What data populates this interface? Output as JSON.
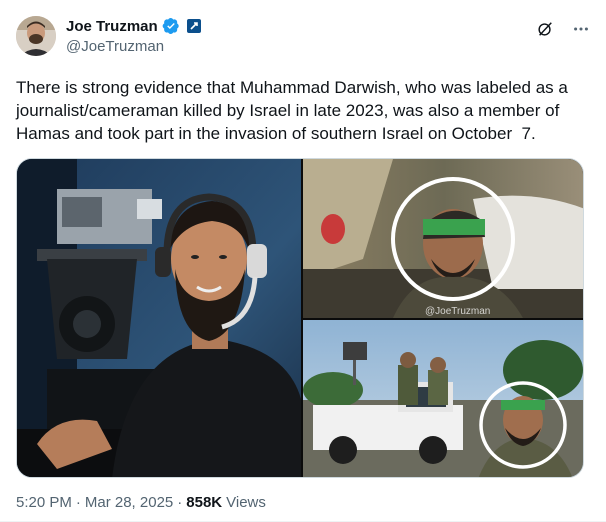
{
  "author": {
    "display_name": "Joe Truzman",
    "handle": "@JoeTruzman",
    "verified_color": "#1d9bf0"
  },
  "tweet": {
    "text": "There is strong evidence that Muhammad Darwish, who was labeled as a journalist/cameraman killed by Israel in late 2023, was also a member of Hamas and took part in the invasion of southern Israel on October  7."
  },
  "media": {
    "watermark": "@JoeTruzman",
    "count": 3
  },
  "meta": {
    "time": "5:20 PM",
    "separator": "·",
    "date": "Mar 28, 2025",
    "views_count": "858K",
    "views_label": "Views"
  },
  "icons": {
    "grok": "grok-icon",
    "more": "more-icon",
    "verified": "verified-badge-icon",
    "affiliation": "affiliation-badge-icon"
  }
}
